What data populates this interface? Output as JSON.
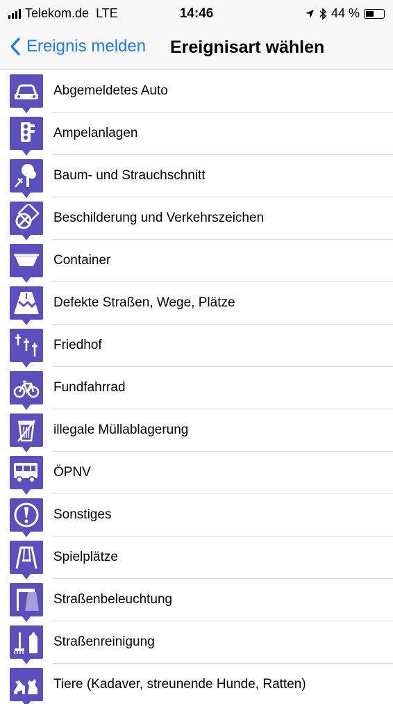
{
  "status_bar": {
    "carrier": "Telekom.de",
    "network": "LTE",
    "time": "14:46",
    "battery": "44 %",
    "battery_level": 0.44
  },
  "nav": {
    "back_label": "Ereignis melden",
    "title": "Ereignisart wählen"
  },
  "items": [
    {
      "label": "Abgemeldetes Auto",
      "icon": "car-icon"
    },
    {
      "label": "Ampelanlagen",
      "icon": "traffic-light-icon"
    },
    {
      "label": "Baum- und Strauchschnitt",
      "icon": "tree-cutting-icon"
    },
    {
      "label": "Beschilderung und Verkehrszeichen",
      "icon": "road-sign-icon"
    },
    {
      "label": "Container",
      "icon": "container-icon"
    },
    {
      "label": "Defekte Straßen, Wege, Plätze",
      "icon": "broken-road-icon"
    },
    {
      "label": "Friedhof",
      "icon": "cemetery-cross-icon"
    },
    {
      "label": "Fundfahrrad",
      "icon": "bicycle-icon"
    },
    {
      "label": "illegale Müllablagerung",
      "icon": "trash-bin-icon"
    },
    {
      "label": "ÖPNV",
      "icon": "bus-icon"
    },
    {
      "label": "Sonstiges",
      "icon": "exclamation-icon"
    },
    {
      "label": "Spielplätze",
      "icon": "swing-icon"
    },
    {
      "label": "Straßenbeleuchtung",
      "icon": "street-lamp-icon"
    },
    {
      "label": "Straßenreinigung",
      "icon": "street-cleaning-icon"
    },
    {
      "label": "Tiere (Kadaver, streunende Hunde, Ratten)",
      "icon": "animals-icon"
    }
  ],
  "colors": {
    "accent": "#1a7cf5",
    "pin": "#5a4fbd"
  }
}
